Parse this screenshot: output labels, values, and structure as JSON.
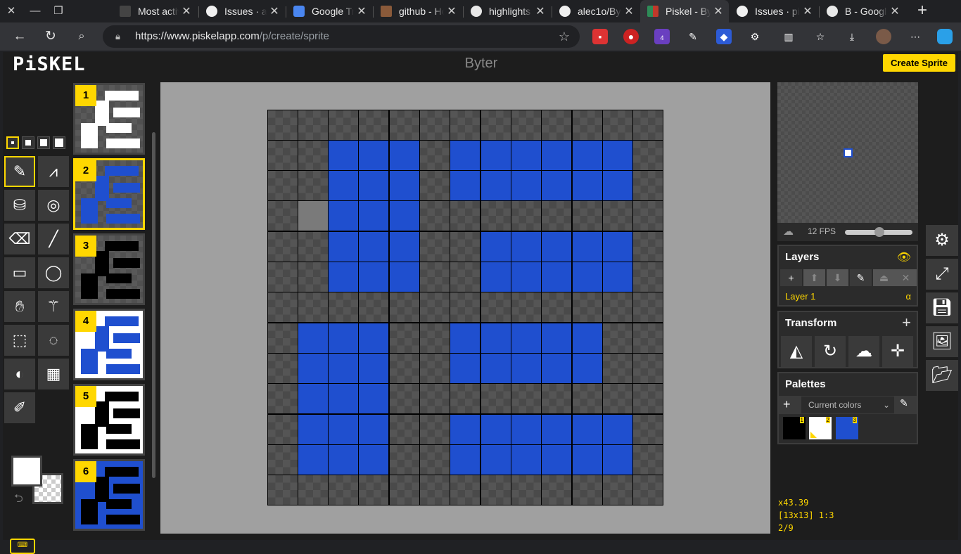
{
  "browser": {
    "tabs": [
      {
        "title": "Most activ",
        "icon": "document-icon"
      },
      {
        "title": "Issues · al",
        "icon": "github-icon"
      },
      {
        "title": "Google Tra",
        "icon": "translate-icon"
      },
      {
        "title": "github - Ho",
        "icon": "stackexchange-icon"
      },
      {
        "title": "highlights",
        "icon": "google-icon"
      },
      {
        "title": "alec1o/By",
        "icon": "github-icon"
      },
      {
        "title": "Piskel - By",
        "icon": "piskel-icon",
        "active": true
      },
      {
        "title": "Issues · pi",
        "icon": "github-icon"
      },
      {
        "title": "B - Google",
        "icon": "google-icon"
      }
    ],
    "url_domain": "https://www.piskelapp.com",
    "url_path": "/p/create/sprite",
    "extension_badge": "4"
  },
  "app": {
    "logo": "PiSKEL",
    "title": "Byter",
    "create_sprite_label": "Create Sprite",
    "frames": [
      {
        "number": "1",
        "style": "white"
      },
      {
        "number": "2",
        "style": "blue",
        "selected": true
      },
      {
        "number": "3",
        "style": "black"
      },
      {
        "number": "4",
        "style": "white-blue"
      },
      {
        "number": "5",
        "style": "white-black"
      },
      {
        "number": "6",
        "style": "blue-black"
      }
    ],
    "fps_label": "12 FPS",
    "fps_value": 12,
    "layers": {
      "title": "Layers",
      "items": [
        {
          "name": "Layer 1",
          "opacity_symbol": "α"
        }
      ]
    },
    "transform": {
      "title": "Transform"
    },
    "palettes": {
      "title": "Palettes",
      "selected": "Current colors",
      "swatches": [
        {
          "number": "1",
          "color": "#000000"
        },
        {
          "number": "2",
          "color": "#ffffff"
        },
        {
          "number": "3",
          "color": "#1f4fcf"
        }
      ]
    },
    "sprite": {
      "columns": 13,
      "rows": 13,
      "pixel_color": "#1f4fcf",
      "highlighted_cell": [
        1,
        3
      ],
      "pattern": [
        "0000000000000",
        "0011101111110",
        "0011101111110",
        "0011100000000",
        "0011100111110",
        "0011100111110",
        "0000000000000",
        "0111001111100",
        "0111001111100",
        "0111000000000",
        "0111001111110",
        "0111001111110",
        "0000000000000"
      ]
    },
    "status": {
      "zoom": "x43.39",
      "size_and_cursor": "[13x13] 1:3",
      "frame_position": "2/9"
    }
  }
}
